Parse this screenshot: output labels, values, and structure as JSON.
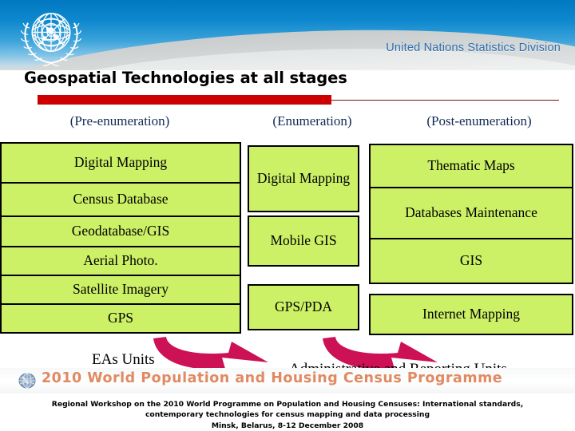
{
  "header": {
    "org_text": "United Nations Statistics Division",
    "emblem_name": "un-emblem",
    "blue_hex": "#0079c2"
  },
  "slide": {
    "title": "Geospatial Technologies at all stages",
    "accent_hex": "#cc0000",
    "box_fill_hex": "#ccf066",
    "arrow_hex": "#cc1155"
  },
  "columns": [
    {
      "header": "(Pre-enumeration)",
      "items": [
        "Digital Mapping",
        "Census Database",
        "Geodatabase/GIS",
        "Aerial Photo.",
        "Satellite Imagery",
        "GPS"
      ]
    },
    {
      "header": "(Enumeration)",
      "items": [
        "Digital Mapping",
        "Mobile GIS",
        "GPS/PDA"
      ]
    },
    {
      "header": "(Post-enumeration)",
      "items": [
        "Thematic Maps",
        "Databases Maintenance",
        "GIS",
        "Internet Mapping"
      ]
    }
  ],
  "units": {
    "left_label": "EAs Units",
    "right_label": "Administrative and Reporting Units"
  },
  "programme": {
    "banner_text": "2010 World Population and Housing Census Programme",
    "banner_color_hex": "#e08a62"
  },
  "footer": {
    "line1": "Regional Workshop on the 2010 World Programme on Population and Housing Censuses: International standards,",
    "line2": "contemporary technologies for census mapping and data processing",
    "line3": "Minsk, Belarus, 8-12 December 2008"
  }
}
